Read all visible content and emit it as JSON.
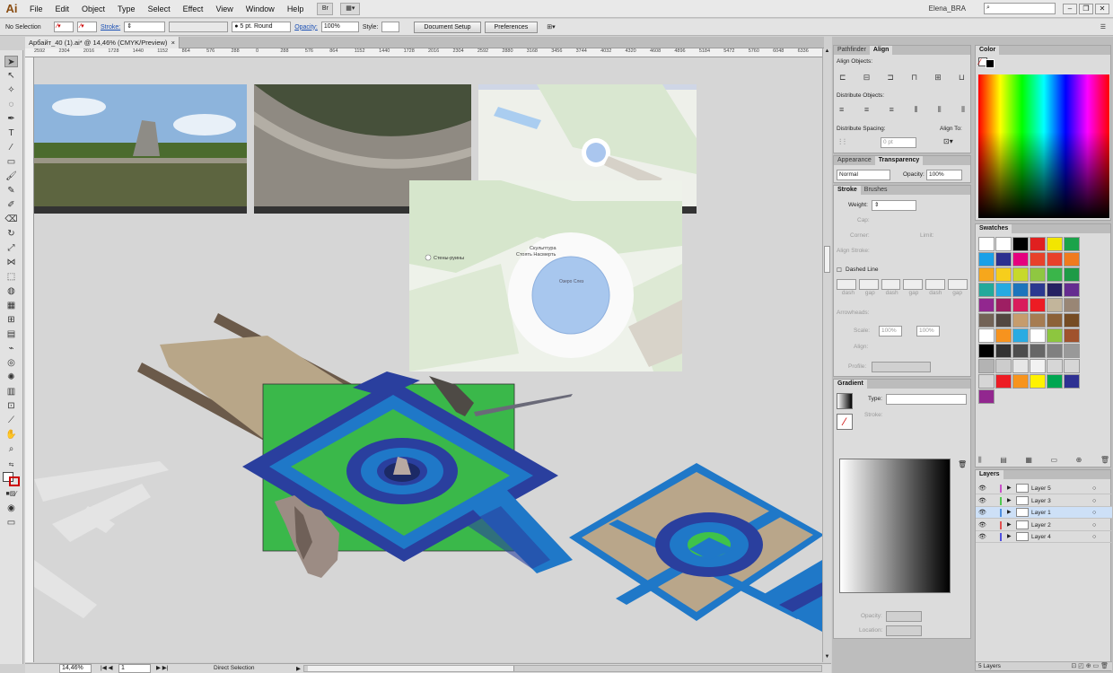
{
  "app": {
    "logo": "Ai",
    "user": "Elena_BRA",
    "search_placeholder": ""
  },
  "menu": [
    "File",
    "Edit",
    "Object",
    "Type",
    "Select",
    "Effect",
    "View",
    "Window",
    "Help"
  ],
  "control_bar": {
    "selection": "No Selection",
    "stroke_label": "Stroke:",
    "brush": "5 pt. Round",
    "opacity_label": "Opacity:",
    "opacity": "100%",
    "style_label": "Style:",
    "document_setup": "Document Setup",
    "preferences": "Preferences"
  },
  "document": {
    "tab_title": "Арбайт_40 (1).ai* @ 14,46% (CMYK/Preview)",
    "ruler_ticks": [
      "2592",
      "2304",
      "2016",
      "1728",
      "1440",
      "1152",
      "864",
      "576",
      "288",
      "0",
      "288",
      "576",
      "864",
      "1152",
      "1440",
      "1728",
      "2016",
      "2304",
      "2592",
      "2880",
      "3168",
      "3456",
      "3744",
      "4032",
      "4320",
      "4608",
      "4896",
      "5184",
      "5472",
      "5760",
      "6048",
      "6336"
    ],
    "map_labels": {
      "large_1": "Скульптура",
      "large_2": "Стоять Насмерть",
      "pond": "Озеро Слез",
      "ruins": "Стены-руины"
    }
  },
  "status": {
    "zoom": "14,46%",
    "page": "1",
    "tool": "Direct Selection"
  },
  "panels": {
    "tabs_top": [
      "Pathfinder",
      "Align"
    ],
    "align": {
      "align_objects": "Align Objects:",
      "distribute_objects": "Distribute Objects:",
      "distribute_spacing": "Distribute Spacing:",
      "align_to": "Align To:",
      "spacing_value": "0 pt"
    },
    "appearance_tabs": [
      "Appearance",
      "Transparency"
    ],
    "transparency": {
      "mode": "Normal",
      "opacity_label": "Opacity:",
      "opacity": "100%"
    },
    "stroke_tabs": [
      "Stroke",
      "Brushes"
    ],
    "stroke": {
      "weight": "Weight:",
      "cap": "Cap:",
      "corner": "Corner:",
      "limit": "Limit:",
      "align_stroke": "Align Stroke:",
      "dashed_line": "Dashed Line",
      "dash": "dash",
      "gap": "gap",
      "arrowheads": "Arrowheads:",
      "scale": "Scale:",
      "scale_value": "100%",
      "align": "Align:",
      "profile": "Profile:"
    },
    "gradient": {
      "title": "Gradient",
      "type": "Type:",
      "stroke": "Stroke:",
      "opacity": "Opacity:",
      "location": "Location:"
    },
    "color_title": "Color",
    "swatches_title": "Swatches",
    "layers_title": "Layers",
    "layers": [
      {
        "name": "Layer 5",
        "color": "#c84fc8"
      },
      {
        "name": "Layer 3",
        "color": "#4fc84f"
      },
      {
        "name": "Layer 1",
        "color": "#4f8fe0"
      },
      {
        "name": "Layer 2",
        "color": "#e04f4f"
      },
      {
        "name": "Layer 4",
        "color": "#4f4fe0"
      }
    ],
    "layers_count": "5 Layers"
  },
  "colors": {
    "green_area": "#3ab84a",
    "blue_outer": "#2a3f9e",
    "blue_inner": "#1f78c8",
    "deck": "#b9a68a"
  }
}
